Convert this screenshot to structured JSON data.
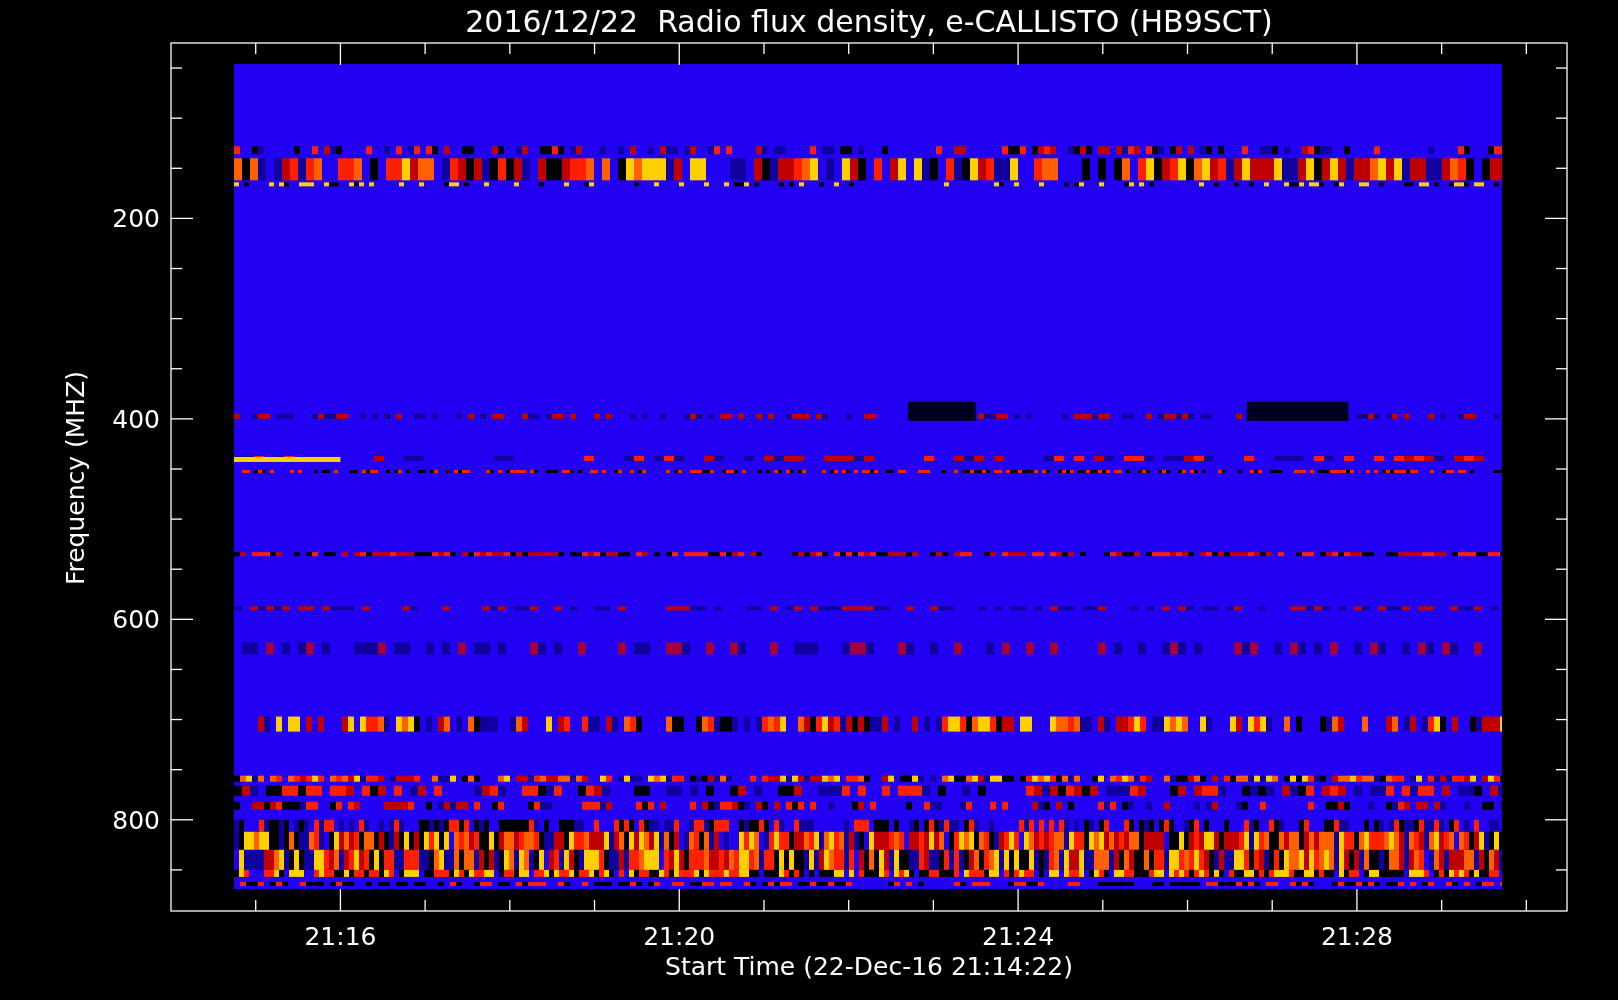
{
  "plot": {
    "title": "2016/12/22  Radio flux density, e-CALLISTO (HB9SCT)",
    "ylabel": "Frequency (MHZ)",
    "xlabel": "Start Time (22-Dec-16 21:14:22)",
    "yticks": [
      "200",
      "400",
      "600",
      "800"
    ],
    "xticks": [
      "21:16",
      "21:20",
      "21:24",
      "21:28"
    ]
  }
}
